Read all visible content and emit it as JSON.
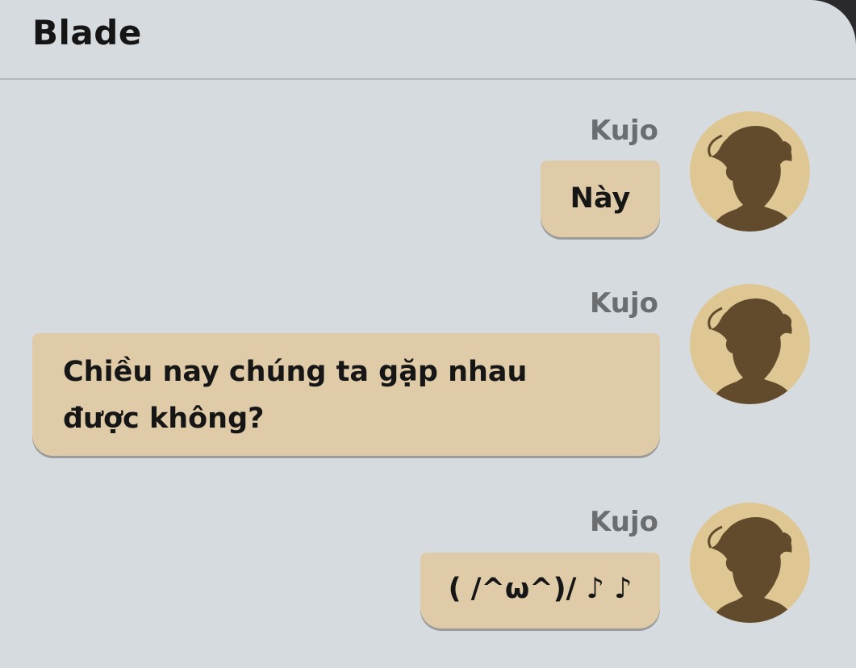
{
  "header": {
    "title": "Blade"
  },
  "messages": [
    {
      "sender": "Kujo",
      "text": "Này",
      "avatar_icon": "person-silhouette-icon"
    },
    {
      "sender": "Kujo",
      "text": "Chiều nay chúng ta gặp nhau được không?",
      "avatar_icon": "person-silhouette-icon"
    },
    {
      "sender": "Kujo",
      "text": "( /^ω^)/ ♪ ♪",
      "avatar_icon": "person-silhouette-icon"
    }
  ],
  "colors": {
    "background": "#d6dbdf",
    "bubble": "#dfcba7",
    "avatar_bg": "#dfc794",
    "avatar_silhouette": "#614b2c",
    "sender_name": "#6a6e70"
  }
}
